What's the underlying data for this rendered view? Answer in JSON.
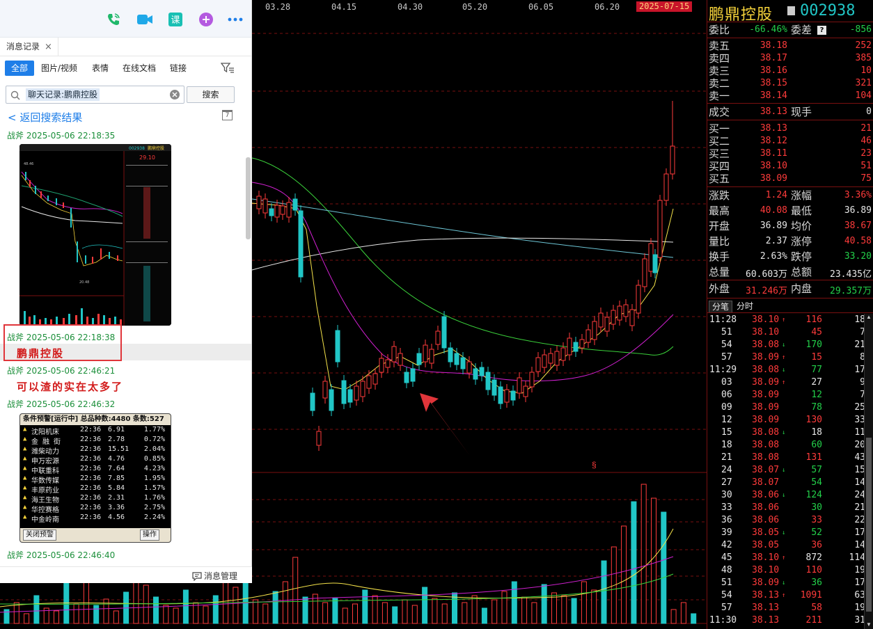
{
  "chart": {
    "dates": [
      "03.28",
      "04.15",
      "04.30",
      "05.20",
      "06.05",
      "06.20"
    ],
    "highlight_date": "2025-07-15",
    "marker_symbol": "§"
  },
  "chat": {
    "tab_label": "消息记录",
    "tab_close": "×",
    "filters": [
      "全部",
      "图片/视频",
      "表情",
      "在线文档",
      "链接"
    ],
    "search_tag": "聊天记录:鹏鼎控股",
    "search_button": "搜索",
    "back_link": "< 返回搜索结果",
    "calendar_day": "7",
    "messages": [
      {
        "sender": "战斧",
        "time": "2025-05-06 22:18:35"
      },
      {
        "sender": "战斧",
        "time": "2025-05-06 22:18:38",
        "text": "鹏鼎控股"
      },
      {
        "sender": "战斧",
        "time": "2025-05-06 22:46:21",
        "text": "可以渣的实在太多了"
      },
      {
        "sender": "战斧",
        "time": "2025-05-06 22:46:32"
      },
      {
        "sender": "战斧",
        "time": "2025-05-06 22:46:40"
      }
    ],
    "thumb1": {
      "code": "002938",
      "name": "鹏鼎控股",
      "price": "29.10",
      "value1": "48.46",
      "value2": "20.48"
    },
    "thumb2": {
      "header": "条件预警[运行中] 总品种数:4480 条数:527",
      "rows": [
        {
          "name": "沈阳机床",
          "time": "22:36",
          "price": "6.91",
          "pct": "1.77%"
        },
        {
          "name": "金 融 街",
          "time": "22:36",
          "price": "2.78",
          "pct": "0.72%"
        },
        {
          "name": "潍柴动力",
          "time": "22:36",
          "price": "15.51",
          "pct": "2.04%"
        },
        {
          "name": "申万宏源",
          "time": "22:36",
          "price": "4.76",
          "pct": "0.85%"
        },
        {
          "name": "中联重科",
          "time": "22:36",
          "price": "7.64",
          "pct": "4.23%"
        },
        {
          "name": "华数传媒",
          "time": "22:36",
          "price": "7.85",
          "pct": "1.95%"
        },
        {
          "name": "丰原药业",
          "time": "22:36",
          "price": "5.84",
          "pct": "1.57%"
        },
        {
          "name": "海王生物",
          "time": "22:36",
          "price": "2.31",
          "pct": "1.76%"
        },
        {
          "name": "华控赛格",
          "time": "22:36",
          "price": "3.36",
          "pct": "2.75%"
        },
        {
          "name": "中金岭南",
          "time": "22:36",
          "price": "4.56",
          "pct": "2.24%"
        }
      ],
      "close_btn": "关闭预警",
      "op_btn": "操作"
    },
    "footer_label": "消息管理"
  },
  "quote": {
    "name": "鹏鼎控股",
    "code": "002938",
    "weibi_label": "委比",
    "weibi": "-66.46%",
    "weicha_label": "委差",
    "weicha": "-856",
    "asks": [
      {
        "label": "卖五",
        "price": "38.18",
        "vol": "252"
      },
      {
        "label": "卖四",
        "price": "38.17",
        "vol": "385"
      },
      {
        "label": "卖三",
        "price": "38.16",
        "vol": "10"
      },
      {
        "label": "卖二",
        "price": "38.15",
        "vol": "321"
      },
      {
        "label": "卖一",
        "price": "38.14",
        "vol": "104"
      }
    ],
    "deal_label": "成交",
    "deal": "38.13",
    "cur_label": "现手",
    "cur": "0",
    "bids": [
      {
        "label": "买一",
        "price": "38.13",
        "vol": "21"
      },
      {
        "label": "买二",
        "price": "38.12",
        "vol": "46"
      },
      {
        "label": "买三",
        "price": "38.11",
        "vol": "23"
      },
      {
        "label": "买四",
        "price": "38.10",
        "vol": "51"
      },
      {
        "label": "买五",
        "price": "38.09",
        "vol": "75"
      }
    ],
    "stats": [
      {
        "l1": "涨跌",
        "v1": "1.24",
        "c1": "red",
        "l2": "涨幅",
        "v2": "3.36%",
        "c2": "red"
      },
      {
        "l1": "最高",
        "v1": "40.08",
        "c1": "red",
        "l2": "最低",
        "v2": "36.89",
        "c2": "wht"
      },
      {
        "l1": "开盘",
        "v1": "36.89",
        "c1": "wht",
        "l2": "均价",
        "v2": "38.67",
        "c2": "red"
      },
      {
        "l1": "量比",
        "v1": "2.37",
        "c1": "wht",
        "l2": "涨停",
        "v2": "40.58",
        "c2": "red"
      },
      {
        "l1": "换手",
        "v1": "2.63%",
        "c1": "wht",
        "l2": "跌停",
        "v2": "33.20",
        "c2": "grn"
      },
      {
        "l1": "总量",
        "v1": "60.603万",
        "c1": "wht",
        "l2": "总额",
        "v2": "23.435亿",
        "c2": "wht"
      }
    ],
    "outer_label": "外盘",
    "outer": "31.246万",
    "inner_label": "内盘",
    "inner": "29.357万",
    "tab_trades": "分笔",
    "tab_time": "分时",
    "trades": [
      {
        "t": "11:28",
        "p": "38.10",
        "a": "↑",
        "v": "116",
        "vc": "red",
        "n": "18"
      },
      {
        "t": "51",
        "p": "38.10",
        "a": "",
        "v": "45",
        "vc": "red",
        "n": "7"
      },
      {
        "t": "54",
        "p": "38.08",
        "a": "↓",
        "v": "170",
        "vc": "grn",
        "n": "21"
      },
      {
        "t": "57",
        "p": "38.09",
        "a": "↑",
        "v": "15",
        "vc": "red",
        "n": "8"
      },
      {
        "t": "11:29",
        "p": "38.08",
        "a": "↓",
        "v": "77",
        "vc": "grn",
        "n": "17"
      },
      {
        "t": "03",
        "p": "38.09",
        "a": "↑",
        "v": "27",
        "vc": "wht",
        "n": "9"
      },
      {
        "t": "06",
        "p": "38.09",
        "a": "",
        "v": "12",
        "vc": "grn",
        "n": "7"
      },
      {
        "t": "09",
        "p": "38.09",
        "a": "",
        "v": "78",
        "vc": "grn",
        "n": "25"
      },
      {
        "t": "12",
        "p": "38.09",
        "a": "",
        "v": "130",
        "vc": "red",
        "n": "33"
      },
      {
        "t": "15",
        "p": "38.08",
        "a": "↓",
        "v": "18",
        "vc": "wht",
        "n": "11"
      },
      {
        "t": "18",
        "p": "38.08",
        "a": "",
        "v": "60",
        "vc": "grn",
        "n": "20"
      },
      {
        "t": "21",
        "p": "38.08",
        "a": "",
        "v": "131",
        "vc": "red",
        "n": "43"
      },
      {
        "t": "24",
        "p": "38.07",
        "a": "↓",
        "v": "57",
        "vc": "grn",
        "n": "15"
      },
      {
        "t": "27",
        "p": "38.07",
        "a": "",
        "v": "54",
        "vc": "grn",
        "n": "14"
      },
      {
        "t": "30",
        "p": "38.06",
        "a": "↓",
        "v": "124",
        "vc": "grn",
        "n": "24"
      },
      {
        "t": "33",
        "p": "38.06",
        "a": "",
        "v": "30",
        "vc": "grn",
        "n": "21"
      },
      {
        "t": "36",
        "p": "38.06",
        "a": "",
        "v": "33",
        "vc": "red",
        "n": "22"
      },
      {
        "t": "39",
        "p": "38.05",
        "a": "↓",
        "v": "52",
        "vc": "grn",
        "n": "17"
      },
      {
        "t": "42",
        "p": "38.05",
        "a": "",
        "v": "36",
        "vc": "red",
        "n": "14"
      },
      {
        "t": "45",
        "p": "38.10",
        "a": "↑",
        "v": "872",
        "vc": "wht",
        "n": "114"
      },
      {
        "t": "48",
        "p": "38.10",
        "a": "",
        "v": "110",
        "vc": "red",
        "n": "19"
      },
      {
        "t": "51",
        "p": "38.09",
        "a": "↓",
        "v": "36",
        "vc": "grn",
        "n": "17"
      },
      {
        "t": "54",
        "p": "38.13",
        "a": "↑",
        "v": "1091",
        "vc": "red",
        "n": "63"
      },
      {
        "t": "57",
        "p": "38.13",
        "a": "",
        "v": "58",
        "vc": "red",
        "n": "19"
      },
      {
        "t": "11:30",
        "p": "38.13",
        "a": "",
        "v": "211",
        "vc": "red",
        "n": "31"
      }
    ]
  },
  "colors": {
    "up": "#ff3b3b",
    "down": "#21c6c6",
    "accent": "#1e7ee8",
    "chat_green": "#1b8f3a"
  },
  "icons": [
    "phone-icon",
    "video-icon",
    "course-icon",
    "add-icon",
    "more-icon",
    "filter-icon",
    "search-icon",
    "clear-icon",
    "calendar-icon",
    "message-manage-icon",
    "arrow-annotation"
  ]
}
